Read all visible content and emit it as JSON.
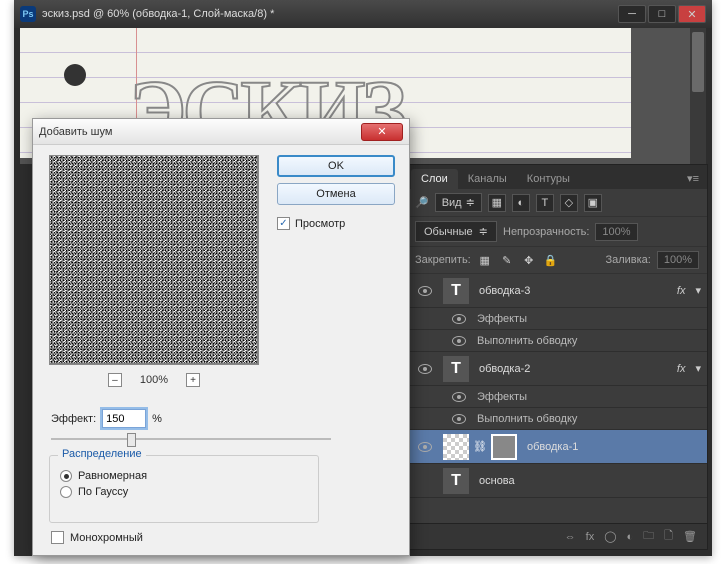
{
  "ps_window": {
    "title": "эскиз.psd @ 60% (обводка-1, Слой-маска/8) *",
    "icon_text": "Ps"
  },
  "canvas": {
    "text": "ЭСКИЗ"
  },
  "layers_panel": {
    "tabs": [
      "Слои",
      "Каналы",
      "Контуры"
    ],
    "kind_label": "Вид",
    "blend_mode": "Обычные",
    "opacity_label": "Непрозрачность:",
    "opacity_value": "100%",
    "lock_label": "Закрепить:",
    "fill_label": "Заливка:",
    "fill_value": "100%",
    "fx_label": "fx",
    "effects_label": "Эффекты",
    "stroke_effect": "Выполнить обводку",
    "layers": [
      {
        "name": "обводка-3",
        "type": "T",
        "fx": true
      },
      {
        "name": "обводка-2",
        "type": "T",
        "fx": true
      },
      {
        "name": "обводка-1",
        "type": "mask",
        "selected": true
      },
      {
        "name": "основа",
        "type": "T"
      }
    ]
  },
  "dialog": {
    "title": "Добавить шум",
    "ok": "OK",
    "cancel": "Отмена",
    "preview": "Просмотр",
    "zoom": "100%",
    "amount_label": "Эффект:",
    "amount_value": "150",
    "amount_unit": "%",
    "distribution_label": "Распределение",
    "dist_uniform": "Равномерная",
    "dist_gaussian": "По Гауссу",
    "monochrome": "Монохромный"
  }
}
